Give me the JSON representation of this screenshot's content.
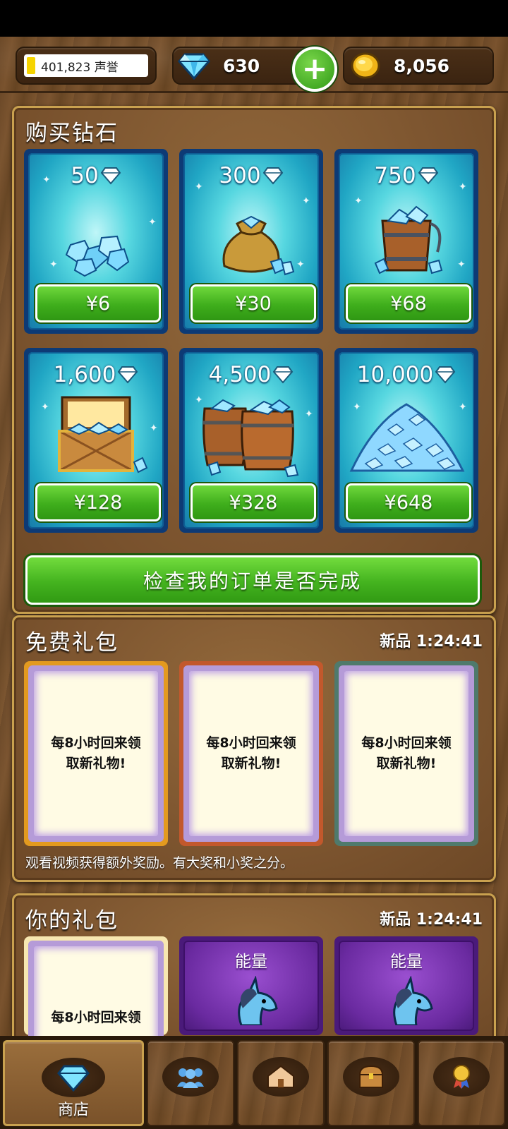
{
  "topbar": {
    "reputation": "401,823 声誉",
    "gems": "630",
    "coins": "8,056"
  },
  "buy_diamonds": {
    "title": "购买钻石",
    "packs": [
      {
        "amount": "50",
        "price": "¥6",
        "art": "diamond-pile-small-icon"
      },
      {
        "amount": "300",
        "price": "¥30",
        "art": "diamond-sack-icon"
      },
      {
        "amount": "750",
        "price": "¥68",
        "art": "diamond-bucket-icon"
      },
      {
        "amount": "1,600",
        "price": "¥128",
        "art": "diamond-chest-icon"
      },
      {
        "amount": "4,500",
        "price": "¥328",
        "art": "diamond-barrels-icon"
      },
      {
        "amount": "10,000",
        "price": "¥648",
        "art": "diamond-mountain-icon"
      }
    ],
    "check_orders": "检查我的订单是否完成"
  },
  "free_gifts": {
    "title": "免费礼包",
    "timer": "新品 1:24:41",
    "cards": [
      {
        "line1": "每8小时回来领",
        "line2": "取新礼物!",
        "frame": "#e39a1f"
      },
      {
        "line1": "每8小时回来领",
        "line2": "取新礼物!",
        "frame": "#c2582c"
      },
      {
        "line1": "每8小时回来领",
        "line2": "取新礼物!",
        "frame": "#4f7a6c"
      }
    ],
    "note": "观看视频获得额外奖励。有大奖和小奖之分。"
  },
  "your_gifts": {
    "title": "你的礼包",
    "timer": "新品 1:24:41",
    "cards": [
      {
        "label": "每8小时回来领"
      },
      {
        "label": "能量"
      },
      {
        "label": "能量"
      }
    ]
  },
  "nav": {
    "shop": "商店",
    "items": [
      "shop-icon",
      "friends-icon",
      "buildings-icon",
      "chest-icon",
      "achievements-icon"
    ]
  },
  "colors": {
    "price_green": "#44b31f",
    "card_cyan": "#20a6c4",
    "wood": "#7a532e",
    "gold_border": "#c9a14f"
  }
}
